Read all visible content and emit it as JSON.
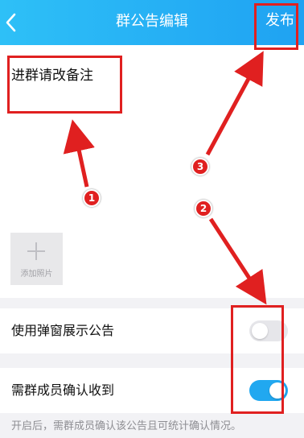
{
  "header": {
    "back_icon": "chevron-left-icon",
    "title": "群公告编辑",
    "publish_label": "发布"
  },
  "editor": {
    "text": "进群请改备注",
    "add_photo_label": "添加照片"
  },
  "settings": {
    "popup": {
      "label": "使用弹窗展示公告",
      "enabled": false
    },
    "confirm": {
      "label": "需群成员确认收到",
      "enabled": true
    }
  },
  "footnote": "开启后，需群成员确认该公告且可统计确认情况。",
  "annotations": {
    "markers": [
      "1",
      "2",
      "3"
    ],
    "color": "#e02020"
  },
  "colors": {
    "header": "#1fa2f2",
    "toggle_on": "#21a8f0"
  }
}
